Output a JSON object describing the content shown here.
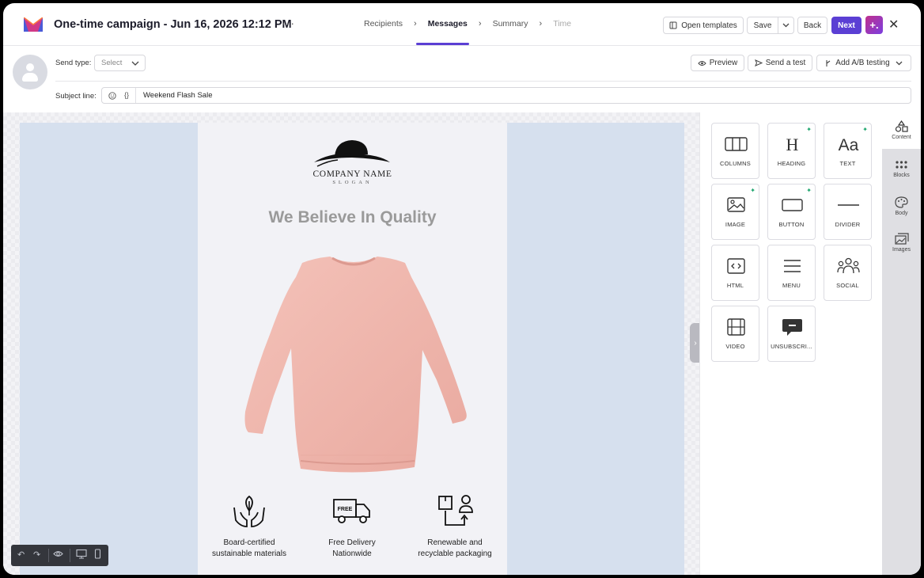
{
  "header": {
    "campaign_title": "One-time campaign - Jun 16, 2026 12:12 PM",
    "more_label": "···",
    "steps": [
      {
        "label": "Recipients"
      },
      {
        "label": "Messages"
      },
      {
        "label": "Summary"
      },
      {
        "label": "Time"
      }
    ],
    "open_templates_label": "Open templates",
    "save_label": "Save",
    "back_label": "Back",
    "next_label": "Next",
    "ai_label": "+.",
    "close_label": "✕"
  },
  "settings": {
    "send_type_label": "Send type:",
    "send_type_value": "Select",
    "preview_label": "Preview",
    "send_test_label": "Send a test",
    "ab_testing_label": "Add A/B testing",
    "subject_label": "Subject line:",
    "subject_value": "Weekend Flash Sale"
  },
  "email": {
    "company_name": "COMPANY NAME",
    "slogan": "SLOGAN",
    "headline": "We Believe In Quality",
    "features": [
      {
        "line1": "Board-certified",
        "line2": "sustainable materials",
        "icon": "hands-leaf-icon"
      },
      {
        "line1": "Free Delivery",
        "line2": "Nationwide",
        "icon": "delivery-truck-icon",
        "badge": "FREE"
      },
      {
        "line1": "Renewable and",
        "line2": "recyclable packaging",
        "icon": "package-person-icon"
      }
    ]
  },
  "content_blocks": [
    {
      "label": "COLUMNS",
      "icon": "columns-icon",
      "ai": false
    },
    {
      "label": "HEADING",
      "icon": "heading-icon",
      "ai": true
    },
    {
      "label": "TEXT",
      "icon": "text-icon",
      "ai": true
    },
    {
      "label": "IMAGE",
      "icon": "image-icon",
      "ai": true
    },
    {
      "label": "BUTTON",
      "icon": "button-icon",
      "ai": true
    },
    {
      "label": "DIVIDER",
      "icon": "divider-icon",
      "ai": false
    },
    {
      "label": "HTML",
      "icon": "html-icon",
      "ai": false
    },
    {
      "label": "MENU",
      "icon": "menu-icon",
      "ai": false
    },
    {
      "label": "SOCIAL",
      "icon": "social-icon",
      "ai": false
    },
    {
      "label": "VIDEO",
      "icon": "video-icon",
      "ai": false
    },
    {
      "label": "UNSUBSCRI...",
      "icon": "unsubscribe-icon",
      "ai": false
    }
  ],
  "rail": [
    {
      "label": "Content",
      "icon": "shapes-icon"
    },
    {
      "label": "Blocks",
      "icon": "blocks-grid-icon"
    },
    {
      "label": "Body",
      "icon": "palette-icon"
    },
    {
      "label": "Images",
      "icon": "images-icon"
    }
  ],
  "colors": {
    "accent": "#5b3fd4",
    "email_background": "#d6e0ee",
    "sweater": "#f0b6ad",
    "ai_sparkle": "#18a36a"
  }
}
